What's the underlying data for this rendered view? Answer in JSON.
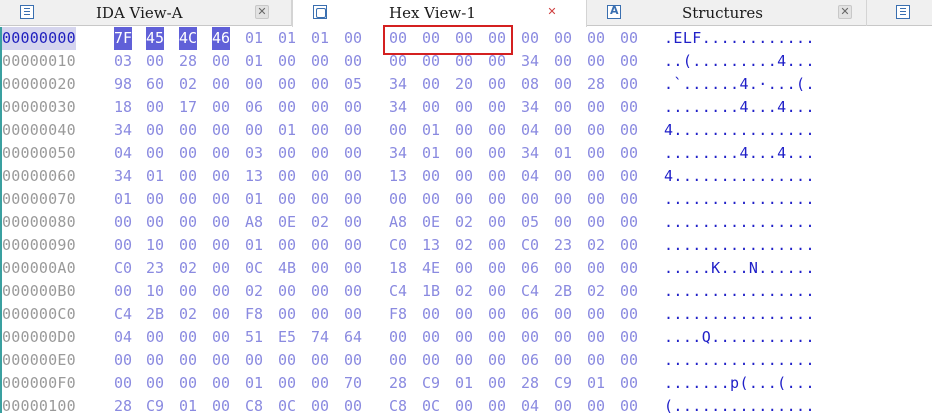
{
  "tabs": [
    {
      "label": "IDA View-A",
      "icon": "ida-view-icon",
      "close": "✕"
    },
    {
      "label": "Hex View-1",
      "icon": "hex-view-icon",
      "close": "✕"
    },
    {
      "label": "Structures",
      "icon": "structures-icon",
      "close": "✕"
    }
  ],
  "hex": {
    "rows": [
      {
        "addr": "00000000",
        "bytes": [
          "7F",
          "45",
          "4C",
          "46",
          "01",
          "01",
          "01",
          "00",
          "00",
          "00",
          "00",
          "00",
          "00",
          "00",
          "00",
          "00"
        ],
        "ascii": ".ELF............"
      },
      {
        "addr": "00000010",
        "bytes": [
          "03",
          "00",
          "28",
          "00",
          "01",
          "00",
          "00",
          "00",
          "00",
          "00",
          "00",
          "00",
          "34",
          "00",
          "00",
          "00"
        ],
        "ascii": "..(.........4..."
      },
      {
        "addr": "00000020",
        "bytes": [
          "98",
          "60",
          "02",
          "00",
          "00",
          "00",
          "00",
          "05",
          "34",
          "00",
          "20",
          "00",
          "08",
          "00",
          "28",
          "00"
        ],
        "ascii": ".`......4.·...(."
      },
      {
        "addr": "00000030",
        "bytes": [
          "18",
          "00",
          "17",
          "00",
          "06",
          "00",
          "00",
          "00",
          "34",
          "00",
          "00",
          "00",
          "34",
          "00",
          "00",
          "00"
        ],
        "ascii": "........4...4..."
      },
      {
        "addr": "00000040",
        "bytes": [
          "34",
          "00",
          "00",
          "00",
          "00",
          "01",
          "00",
          "00",
          "00",
          "01",
          "00",
          "00",
          "04",
          "00",
          "00",
          "00"
        ],
        "ascii": "4..............."
      },
      {
        "addr": "00000050",
        "bytes": [
          "04",
          "00",
          "00",
          "00",
          "03",
          "00",
          "00",
          "00",
          "34",
          "01",
          "00",
          "00",
          "34",
          "01",
          "00",
          "00"
        ],
        "ascii": "........4...4..."
      },
      {
        "addr": "00000060",
        "bytes": [
          "34",
          "01",
          "00",
          "00",
          "13",
          "00",
          "00",
          "00",
          "13",
          "00",
          "00",
          "00",
          "04",
          "00",
          "00",
          "00"
        ],
        "ascii": "4..............."
      },
      {
        "addr": "00000070",
        "bytes": [
          "01",
          "00",
          "00",
          "00",
          "01",
          "00",
          "00",
          "00",
          "00",
          "00",
          "00",
          "00",
          "00",
          "00",
          "00",
          "00"
        ],
        "ascii": "................"
      },
      {
        "addr": "00000080",
        "bytes": [
          "00",
          "00",
          "00",
          "00",
          "A8",
          "0E",
          "02",
          "00",
          "A8",
          "0E",
          "02",
          "00",
          "05",
          "00",
          "00",
          "00"
        ],
        "ascii": "................"
      },
      {
        "addr": "00000090",
        "bytes": [
          "00",
          "10",
          "00",
          "00",
          "01",
          "00",
          "00",
          "00",
          "C0",
          "13",
          "02",
          "00",
          "C0",
          "23",
          "02",
          "00"
        ],
        "ascii": "................"
      },
      {
        "addr": "000000A0",
        "bytes": [
          "C0",
          "23",
          "02",
          "00",
          "0C",
          "4B",
          "00",
          "00",
          "18",
          "4E",
          "00",
          "00",
          "06",
          "00",
          "00",
          "00"
        ],
        "ascii": ".....K...N......"
      },
      {
        "addr": "000000B0",
        "bytes": [
          "00",
          "10",
          "00",
          "00",
          "02",
          "00",
          "00",
          "00",
          "C4",
          "1B",
          "02",
          "00",
          "C4",
          "2B",
          "02",
          "00"
        ],
        "ascii": "................"
      },
      {
        "addr": "000000C0",
        "bytes": [
          "C4",
          "2B",
          "02",
          "00",
          "F8",
          "00",
          "00",
          "00",
          "F8",
          "00",
          "00",
          "00",
          "06",
          "00",
          "00",
          "00"
        ],
        "ascii": "................"
      },
      {
        "addr": "000000D0",
        "bytes": [
          "04",
          "00",
          "00",
          "00",
          "51",
          "E5",
          "74",
          "64",
          "00",
          "00",
          "00",
          "00",
          "00",
          "00",
          "00",
          "00"
        ],
        "ascii": "....Q..........."
      },
      {
        "addr": "000000E0",
        "bytes": [
          "00",
          "00",
          "00",
          "00",
          "00",
          "00",
          "00",
          "00",
          "00",
          "00",
          "00",
          "00",
          "06",
          "00",
          "00",
          "00"
        ],
        "ascii": "................"
      },
      {
        "addr": "000000F0",
        "bytes": [
          "00",
          "00",
          "00",
          "00",
          "01",
          "00",
          "00",
          "70",
          "28",
          "C9",
          "01",
          "00",
          "28",
          "C9",
          "01",
          "00"
        ],
        "ascii": ".......p(...(..."
      },
      {
        "addr": "00000100",
        "bytes": [
          "28",
          "C9",
          "01",
          "00",
          "C8",
          "0C",
          "00",
          "00",
          "C8",
          "0C",
          "00",
          "00",
          "04",
          "00",
          "00",
          "00"
        ],
        "ascii": "(..............."
      }
    ]
  },
  "colors": {
    "selection": "#6060d8",
    "hex_text": "#8a8ae0",
    "ascii_text": "#2020c8",
    "highlight_box": "#d42020"
  }
}
